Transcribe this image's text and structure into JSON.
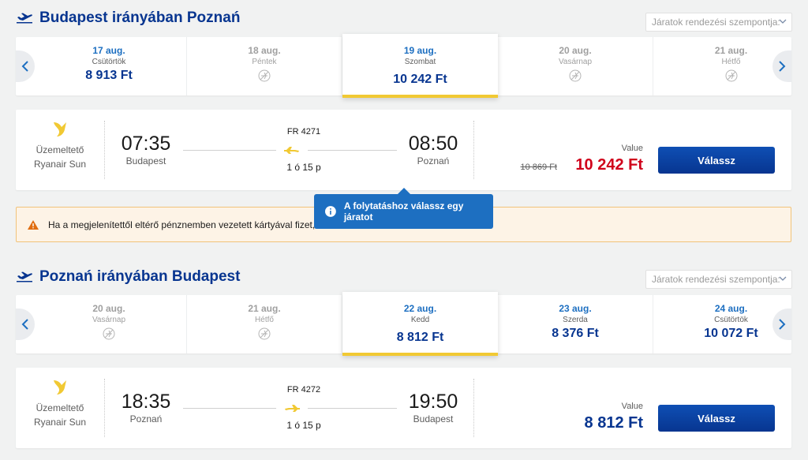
{
  "outbound": {
    "title": "Budapest irányában Poznań",
    "sort_placeholder": "Járatok rendezési szempontja:",
    "days": [
      {
        "date": "17 aug.",
        "weekday": "Csütörtök",
        "price": "8 913 Ft",
        "state": "available"
      },
      {
        "date": "18 aug.",
        "weekday": "Péntek",
        "price": "",
        "state": "unavailable"
      },
      {
        "date": "19 aug.",
        "weekday": "Szombat",
        "price": "10 242 Ft",
        "state": "selected"
      },
      {
        "date": "20 aug.",
        "weekday": "Vasárnap",
        "price": "",
        "state": "unavailable"
      },
      {
        "date": "21 aug.",
        "weekday": "Hétfő",
        "price": "",
        "state": "unavailable"
      }
    ],
    "flight": {
      "operator_label": "Üzemeltető",
      "operator_name": "Ryanair Sun",
      "depart_time": "07:35",
      "depart_place": "Budapest",
      "flight_number": "FR 4271",
      "duration": "1 ó 15 p",
      "arrive_time": "08:50",
      "arrive_place": "Poznań",
      "fare_label": "Value",
      "old_price": "10 869 Ft",
      "price": "10 242 Ft",
      "button": "Válassz"
    }
  },
  "warning": {
    "text": "Ha a megjelenítettől eltérő pénznemben vezetett kártyával fizet, a"
  },
  "tooltip": {
    "text": "A folytatáshoz válassz egy járatot"
  },
  "inbound": {
    "title": "Poznań irányában Budapest",
    "sort_placeholder": "Járatok rendezési szempontja:",
    "days": [
      {
        "date": "20 aug.",
        "weekday": "Vasárnap",
        "price": "",
        "state": "unavailable"
      },
      {
        "date": "21 aug.",
        "weekday": "Hétfő",
        "price": "",
        "state": "unavailable"
      },
      {
        "date": "22 aug.",
        "weekday": "Kedd",
        "price": "8 812 Ft",
        "state": "selected"
      },
      {
        "date": "23 aug.",
        "weekday": "Szerda",
        "price": "8 376 Ft",
        "state": "available"
      },
      {
        "date": "24 aug.",
        "weekday": "Csütörtök",
        "price": "10 072 Ft",
        "state": "available"
      }
    ],
    "flight": {
      "operator_label": "Üzemeltető",
      "operator_name": "Ryanair Sun",
      "depart_time": "18:35",
      "depart_place": "Poznań",
      "flight_number": "FR 4272",
      "duration": "1 ó 15 p",
      "arrive_time": "19:50",
      "arrive_place": "Budapest",
      "fare_label": "Value",
      "price": "8 812 Ft",
      "button": "Válassz"
    }
  },
  "colors": {
    "brand_blue": "#073590",
    "link_blue": "#1d6fc1",
    "price_red": "#d0021b",
    "accent_yellow": "#f1c933",
    "warning_bg": "#fdf3e6"
  },
  "icons": {
    "section": "plane-takeoff-icon",
    "nav_left": "chevron-left-icon",
    "nav_right": "chevron-right-icon",
    "no_flight": "no-flight-icon",
    "operator": "ryanair-harp-logo",
    "warning": "warning-triangle-icon",
    "info": "info-icon"
  }
}
